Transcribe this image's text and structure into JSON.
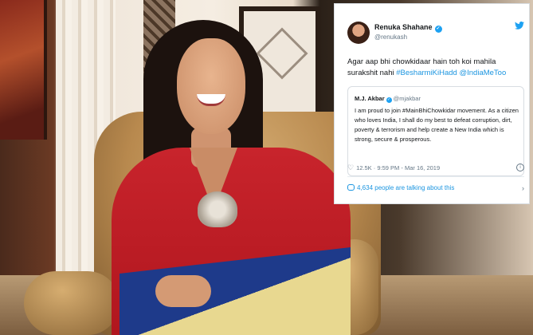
{
  "tweet": {
    "author_name": "Renuka Shahane",
    "author_handle": "@renukash",
    "text_plain": "Agar aap bhi chowkidaar hain toh koi mahila surakshit nahi ",
    "hashtag_1": "#BesharmiKiHadd",
    "hashtag_2": "@IndiaMeToo",
    "quoted": {
      "author_name": "M.J. Akbar",
      "author_handle": "@mjakbar",
      "text": "I am proud to join #MainBhiChowkidar movement. As a citizen who loves India, I shall do my best to defeat corruption, dirt, poverty & terrorism and help create a New India which is strong, secure & prosperous."
    },
    "likes": "12.5K",
    "timestamp": "9:59 PM - Mar 16, 2019",
    "talking": "4,634 people are talking about this",
    "icons": {
      "verified": "verified-badge-icon",
      "bird": "twitter-bird-icon",
      "heart": "heart-icon",
      "info": "info-icon",
      "comment": "comment-icon",
      "chevron": "chevron-right-icon"
    },
    "colors": {
      "link": "#1b95e0",
      "verified": "#1da1f2",
      "muted": "#657786"
    }
  }
}
